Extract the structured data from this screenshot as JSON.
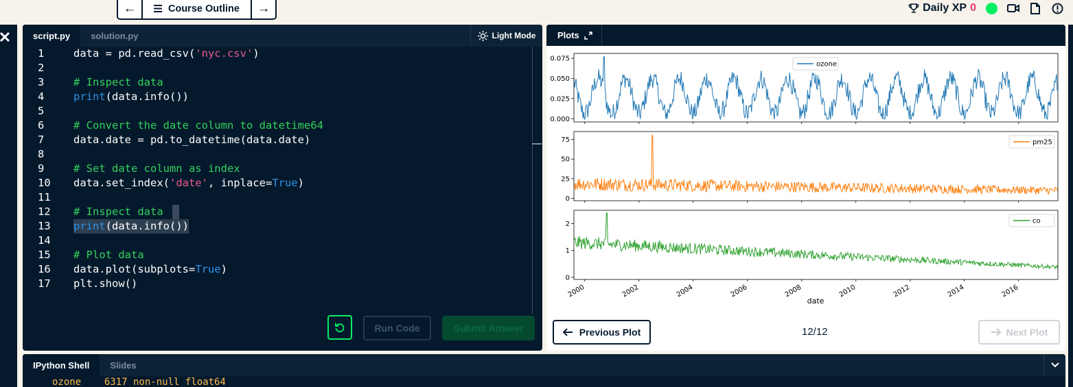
{
  "topbar": {
    "back_label": "←",
    "outline_label": "Course Outline",
    "forward_label": "→",
    "daily_xp_label": "Daily XP",
    "daily_xp_value": "0",
    "status_color": "#03ef62",
    "icons": [
      "trophy-icon",
      "video-icon",
      "document-icon",
      "info-icon"
    ]
  },
  "editor": {
    "tabs": [
      {
        "label": "script.py",
        "active": true
      },
      {
        "label": "solution.py",
        "active": false
      }
    ],
    "light_mode_label": "Light Mode",
    "lines": [
      {
        "n": "1"
      },
      {
        "n": "2"
      },
      {
        "n": "3"
      },
      {
        "n": "4"
      },
      {
        "n": "5"
      },
      {
        "n": "6"
      },
      {
        "n": "7"
      },
      {
        "n": "8"
      },
      {
        "n": "9"
      },
      {
        "n": "10"
      },
      {
        "n": "11"
      },
      {
        "n": "12"
      },
      {
        "n": "13"
      },
      {
        "n": "14"
      },
      {
        "n": "15"
      },
      {
        "n": "16"
      },
      {
        "n": "17"
      }
    ],
    "code": {
      "l1_a": "data = pd.read_csv(",
      "l1_b": "'nyc.csv'",
      "l1_c": ")",
      "l3": "# Inspect data",
      "l4_a": "print",
      "l4_b": "(data.info())",
      "l6": "# Convert the date column to datetime64",
      "l7": "data.date = pd.to_datetime(data.date)",
      "l9": "# Set date column as index",
      "l10_a": "data.set_index(",
      "l10_b": "'date'",
      "l10_c": ", inplace=",
      "l10_d": "True",
      "l10_e": ")",
      "l12": "# Inspect data",
      "l13_a": "print",
      "l13_b": "(data.info())",
      "l15": "# Plot data",
      "l16_a": "data.plot(subplots=",
      "l16_b": "True",
      "l16_c": ")",
      "l17": "plt.show()"
    },
    "run_label": "Run Code",
    "submit_label": "Submit Answer"
  },
  "plots": {
    "tab_label": "Plots",
    "prev_label": "Previous Plot",
    "next_label": "Next Plot",
    "pager": "12/12"
  },
  "shell": {
    "tabs": [
      {
        "label": "IPython Shell",
        "active": true
      },
      {
        "label": "Slides",
        "active": false
      }
    ],
    "output": "ozone    6317 non-null float64"
  },
  "chart_data": {
    "type": "line",
    "xlabel": "date",
    "x_ticks": [
      "2000",
      "2002",
      "2004",
      "2006",
      "2008",
      "2010",
      "2012",
      "2014",
      "2016"
    ],
    "xlim": [
      1999.6,
      2017.45
    ],
    "subplots": [
      {
        "legend": "ozone",
        "color": "#1f77b4",
        "ylim": [
          -0.004,
          0.081
        ],
        "y_ticks": [
          "0.000",
          "0.025",
          "0.050",
          "0.075"
        ],
        "y_tick_values": [
          0,
          0.025,
          0.05,
          0.075
        ],
        "legend_position": "top-center",
        "pattern": {
          "base": 0.028,
          "seasonal_amplitude": 0.022,
          "noise": 0.012,
          "peak": {
            "x": 2000.7,
            "y": 0.077
          }
        }
      },
      {
        "legend": "pm25",
        "color": "#ff7f0e",
        "ylim": [
          -3,
          85
        ],
        "y_ticks": [
          "0",
          "25",
          "50",
          "75"
        ],
        "y_tick_values": [
          0,
          25,
          50,
          75
        ],
        "legend_position": "top-right",
        "pattern": {
          "start_level": 15,
          "end_level": 8,
          "noise": 9,
          "peak": {
            "x": 2002.5,
            "y": 80
          }
        }
      },
      {
        "legend": "co",
        "color": "#2ca02c",
        "ylim": [
          -0.08,
          2.5
        ],
        "y_ticks": [
          "0",
          "1",
          "2"
        ],
        "y_tick_values": [
          0,
          1,
          2
        ],
        "legend_position": "top-right",
        "pattern": {
          "start_level": 1.2,
          "end_level": 0.35,
          "noise": 0.25,
          "peak": {
            "x": 2000.8,
            "y": 2.4
          }
        }
      }
    ]
  }
}
